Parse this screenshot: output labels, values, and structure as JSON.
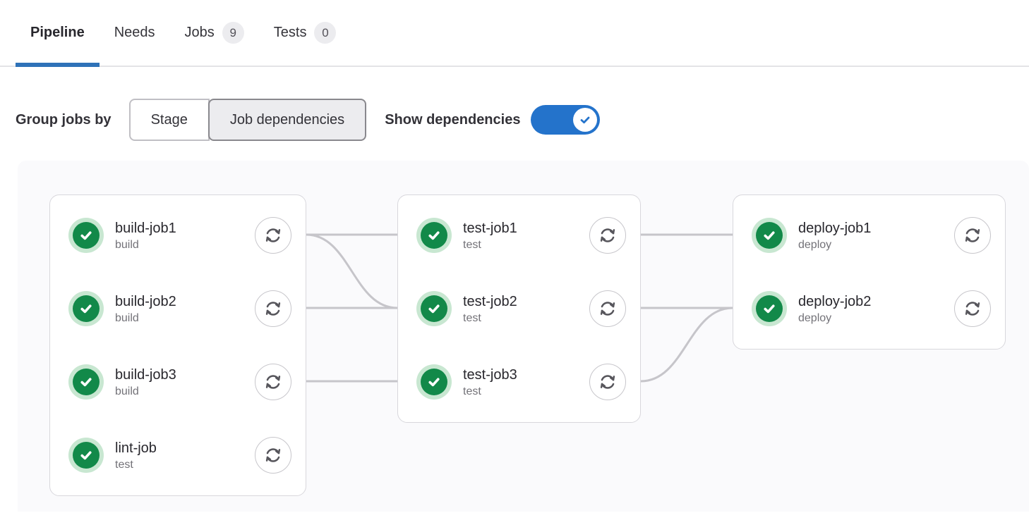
{
  "tabs": [
    {
      "label": "Pipeline",
      "badge": null,
      "active": true
    },
    {
      "label": "Needs",
      "badge": null,
      "active": false
    },
    {
      "label": "Jobs",
      "badge": "9",
      "active": false
    },
    {
      "label": "Tests",
      "badge": "0",
      "active": false
    }
  ],
  "controls": {
    "group_label": "Group jobs by",
    "group_options": [
      {
        "label": "Stage",
        "selected": false
      },
      {
        "label": "Job dependencies",
        "selected": true
      }
    ],
    "show_dependencies_label": "Show dependencies",
    "show_dependencies_on": true
  },
  "pipeline_graph": {
    "columns": [
      {
        "jobs": [
          {
            "name": "build-job1",
            "stage": "build",
            "status": "success",
            "action": "retry"
          },
          {
            "name": "build-job2",
            "stage": "build",
            "status": "success",
            "action": "retry"
          },
          {
            "name": "build-job3",
            "stage": "build",
            "status": "success",
            "action": "retry"
          },
          {
            "name": "lint-job",
            "stage": "test",
            "status": "success",
            "action": "retry"
          }
        ]
      },
      {
        "jobs": [
          {
            "name": "test-job1",
            "stage": "test",
            "status": "success",
            "action": "retry"
          },
          {
            "name": "test-job2",
            "stage": "test",
            "status": "success",
            "action": "retry"
          },
          {
            "name": "test-job3",
            "stage": "test",
            "status": "success",
            "action": "retry"
          }
        ]
      },
      {
        "jobs": [
          {
            "name": "deploy-job1",
            "stage": "deploy",
            "status": "success",
            "action": "retry"
          },
          {
            "name": "deploy-job2",
            "stage": "deploy",
            "status": "success",
            "action": "retry"
          }
        ]
      }
    ],
    "connections": [
      {
        "from": "build-job1",
        "to": "test-job1"
      },
      {
        "from": "build-job1",
        "to": "test-job2"
      },
      {
        "from": "build-job2",
        "to": "test-job2"
      },
      {
        "from": "build-job3",
        "to": "test-job3"
      },
      {
        "from": "test-job1",
        "to": "deploy-job1"
      },
      {
        "from": "test-job2",
        "to": "deploy-job2"
      },
      {
        "from": "test-job3",
        "to": "deploy-job2"
      }
    ]
  },
  "icons": {
    "job_status": "check-circle-icon",
    "job_action": "retry-icon",
    "toggle_state": "check-icon"
  },
  "colors": {
    "accent_blue": "#2473cb",
    "tab_indicator_blue": "#2e72b8",
    "success_green": "#128949",
    "success_ring_green": "#c8e7d1",
    "dependency_line_gray": "#c6c5ca",
    "panel_background": "#fafafc"
  }
}
